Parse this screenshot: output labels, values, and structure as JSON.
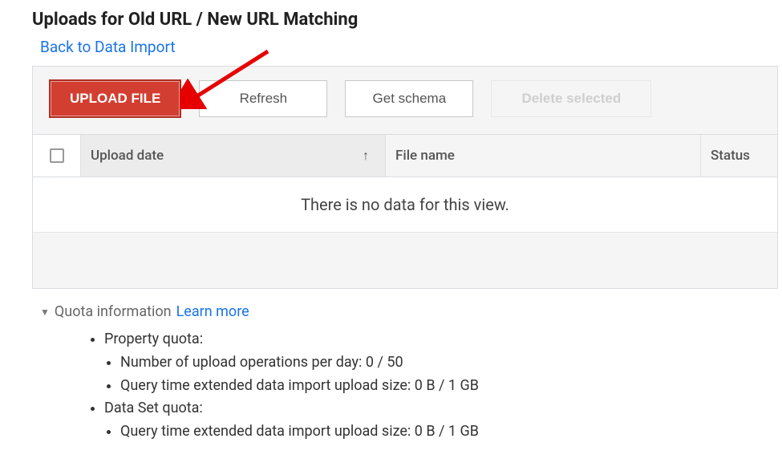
{
  "header": {
    "title": "Uploads for Old URL / New URL Matching",
    "back_link": "Back to Data Import"
  },
  "toolbar": {
    "upload_label": "UPLOAD FILE",
    "refresh_label": "Refresh",
    "schema_label": "Get schema",
    "delete_label": "Delete selected"
  },
  "table": {
    "columns": {
      "upload_date": "Upload date",
      "file_name": "File name",
      "status": "Status"
    },
    "empty_message": "There is no data for this view."
  },
  "quota": {
    "title": "Quota information",
    "learn_more": "Learn more",
    "property_label": "Property quota:",
    "property_ops": "Number of upload operations per day: 0 / 50",
    "property_size": "Query time extended data import upload size: 0 B / 1 GB",
    "dataset_label": "Data Set quota:",
    "dataset_size": "Query time extended data import upload size: 0 B / 1 GB"
  }
}
